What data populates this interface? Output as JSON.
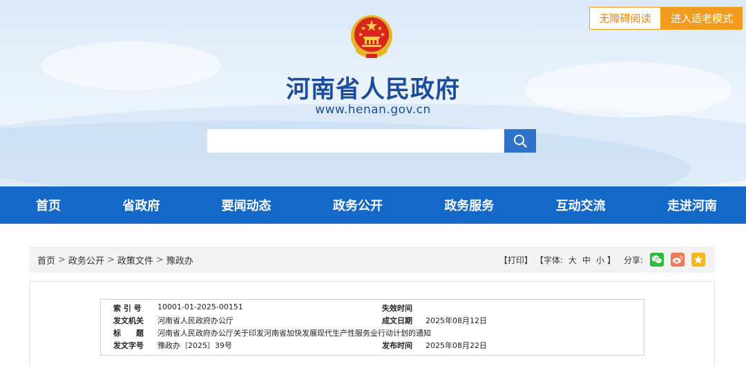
{
  "header": {
    "accessibility_label": "无障碍阅读",
    "elder_mode_label": "进入适老模式",
    "site_title": "河南省人民政府",
    "site_url": "www.henan.gov.cn",
    "search_placeholder": "",
    "search_icon": "search-icon",
    "emblem_icon": "national-emblem-icon"
  },
  "nav": {
    "items": [
      "首页",
      "省政府",
      "要闻动态",
      "政务公开",
      "政务服务",
      "互动交流",
      "走进河南"
    ]
  },
  "breadcrumb": {
    "items": [
      "首页",
      "政务公开",
      "政策文件",
      "豫政办"
    ],
    "separator": ">"
  },
  "tools": {
    "print": "【打印】",
    "font_label": "【字体:",
    "font_large": "大",
    "font_medium": "中",
    "font_small": "小",
    "font_close": "】",
    "share_label": "分享:",
    "share_icons": [
      "wechat-icon",
      "weibo-icon",
      "favorite-icon"
    ]
  },
  "meta": {
    "index_label": "索 引 号",
    "index_value": "10001-01-2025-00151",
    "expiry_label": "失效时间",
    "expiry_value": "",
    "issuer_label": "发文机关",
    "issuer_value": "河南省人民政府办公厅",
    "date_label": "成文日期",
    "date_value": "2025年08月12日",
    "title_label": "标　　题",
    "title_value": "河南省人民政府办公厅关于印发河南省加快发展现代生产性服务业行动计划的通知",
    "docno_label": "发文字号",
    "docno_value": "豫政办〔2025〕39号",
    "publish_label": "发布时间",
    "publish_value": "2025年08月22日"
  },
  "colors": {
    "brand_blue": "#1468c7",
    "title_blue": "#1c4d9c",
    "accent_orange": "#f29c1f",
    "emblem_red": "#d9261c",
    "emblem_gold": "#f2c230"
  }
}
